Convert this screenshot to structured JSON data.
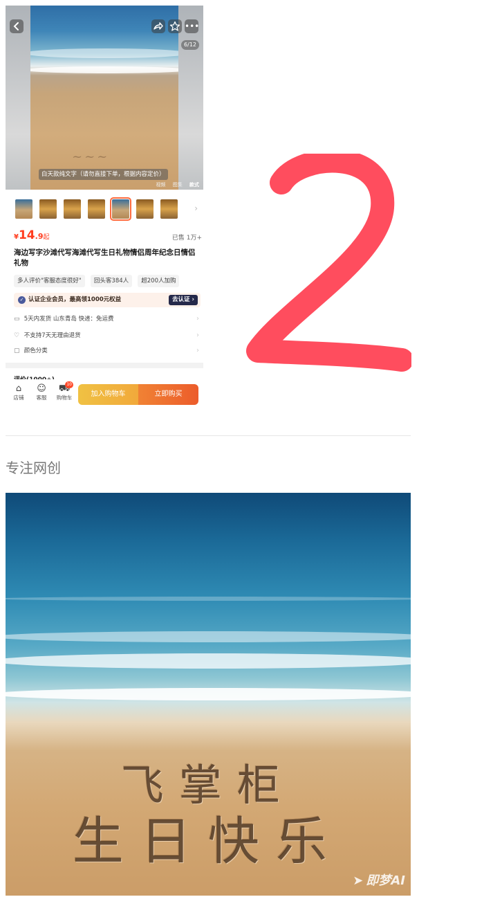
{
  "product": {
    "image_counter": "6/12",
    "image_caption": "白天款纯文字（请勿直接下单，根据内容定价）",
    "media_tabs": [
      "视频",
      "图集",
      "款式"
    ],
    "price": {
      "currency": "¥",
      "integer": "14",
      "decimal": ".9",
      "suffix": "起"
    },
    "sold": "已售 1万+",
    "title": "海边写字沙滩代写海滩代写生日礼物情侣周年纪念日情侣礼物",
    "tags": [
      "多人评价\"客服态度很好\"",
      "回头客384人",
      "超200人加购"
    ],
    "verify": {
      "text": "认证企业会员，最高领1000元权益",
      "button": "去认证 ›"
    },
    "info_rows": [
      {
        "icon": "truck-icon",
        "text": "5天内发货  山东青岛  快递：免运费"
      },
      {
        "icon": "shield-icon",
        "text": "不支持7天无理由退货"
      },
      {
        "icon": "clipboard-icon",
        "text": "颜色分类"
      }
    ],
    "review_peek": "评价(1000+)",
    "bottom_bar": {
      "shop": "店铺",
      "service": "客服",
      "cart": "购物车",
      "cart_badge": "10",
      "add_to_cart": "加入购物车",
      "buy_now": "立即购买"
    }
  },
  "annotation_number": "2",
  "article": {
    "caption": "专注网创",
    "beach_text_line1": "飞掌柜",
    "beach_text_line2": "生日快乐",
    "watermark": "即梦AI"
  },
  "colors": {
    "price": "#ff3d1f",
    "annotation": "#ff4d5e",
    "cart_button": "#f0b93f",
    "buy_button": "#ec6a2e",
    "verify_button": "#25294a"
  }
}
